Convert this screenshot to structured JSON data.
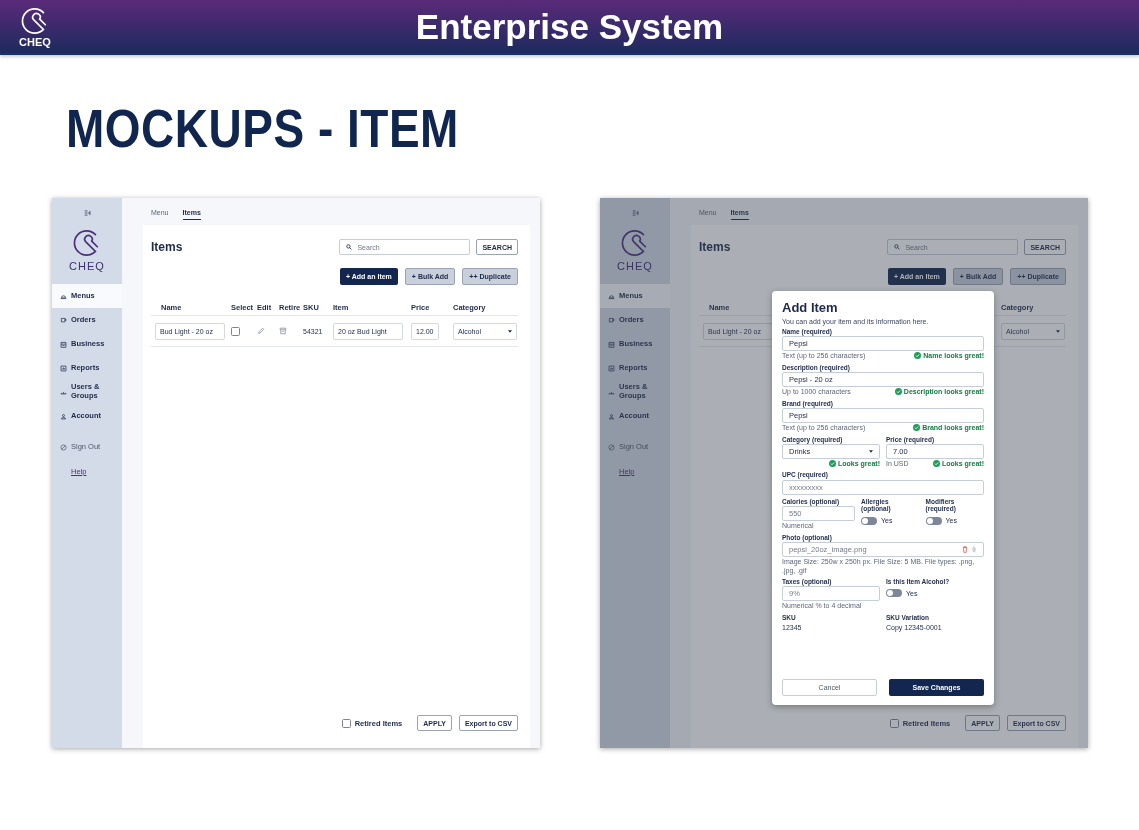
{
  "header": {
    "logo_text": "CHEQ",
    "title": "Enterprise System"
  },
  "slide_title": "MOCKUPS - ITEM",
  "mockups": [
    {
      "dimmed": false,
      "sidebar": {
        "logo_text": "CHEQ",
        "items": [
          {
            "kind": "nav",
            "label": "Menus",
            "selected": true
          },
          {
            "kind": "nav",
            "label": "Orders",
            "selected": false
          },
          {
            "kind": "nav",
            "label": "Business",
            "selected": false
          },
          {
            "kind": "nav",
            "label": "Reports",
            "selected": false
          },
          {
            "kind": "nav",
            "label": "Users & Groups",
            "selected": false
          },
          {
            "kind": "nav",
            "label": "Account",
            "selected": false
          },
          {
            "kind": "signout",
            "label": "Sign Out",
            "selected": false
          },
          {
            "kind": "link",
            "label": "Help",
            "selected": false
          }
        ]
      },
      "tabs": [
        {
          "label": "Menu",
          "selected": false
        },
        {
          "label": "Items",
          "selected": true
        }
      ],
      "page_title": "Items",
      "search": {
        "placeholder": "Search",
        "button": "SEARCH"
      },
      "actions": [
        {
          "kind": "primary",
          "label": "+ Add an Item"
        },
        {
          "kind": "secondary",
          "label": "+ Bulk Add"
        },
        {
          "kind": "secondary",
          "label": "++ Duplicate"
        }
      ],
      "table": {
        "columns": [
          {
            "kind": "name",
            "label": "Name"
          },
          {
            "kind": "select",
            "label": "Select"
          },
          {
            "kind": "edit",
            "label": "Edit"
          },
          {
            "kind": "retire",
            "label": "Retire"
          },
          {
            "kind": "sku",
            "label": "SKU"
          },
          {
            "kind": "item",
            "label": "Item"
          },
          {
            "kind": "price",
            "label": "Price"
          },
          {
            "kind": "category",
            "label": "Category"
          }
        ],
        "rows": [
          {
            "cells": [
              {
                "kind": "field",
                "value": "Bud Light - 20 oz"
              },
              {
                "kind": "checkbox",
                "checked": false
              },
              {
                "kind": "edit"
              },
              {
                "kind": "retire"
              },
              {
                "kind": "text",
                "value": "54321"
              },
              {
                "kind": "field",
                "value": "20 oz Bud Light"
              },
              {
                "kind": "field",
                "value": "12.00"
              },
              {
                "kind": "dropdown",
                "value": "Alcohol"
              }
            ]
          }
        ]
      },
      "footer": {
        "retired": {
          "label": "Retired Items",
          "checked": false
        },
        "buttons": [
          "APPLY",
          "Export to CSV"
        ]
      }
    },
    {
      "dimmed": true,
      "sidebar": {
        "logo_text": "CHEQ",
        "items": [
          {
            "kind": "nav",
            "label": "Menus",
            "selected": true
          },
          {
            "kind": "nav",
            "label": "Orders",
            "selected": false
          },
          {
            "kind": "nav",
            "label": "Business",
            "selected": false
          },
          {
            "kind": "nav",
            "label": "Reports",
            "selected": false
          },
          {
            "kind": "nav",
            "label": "Users & Groups",
            "selected": false
          },
          {
            "kind": "nav",
            "label": "Account",
            "selected": false
          },
          {
            "kind": "signout",
            "label": "Sign Out",
            "selected": false
          },
          {
            "kind": "link",
            "label": "Help",
            "selected": false
          }
        ]
      },
      "tabs": [
        {
          "label": "Menu",
          "selected": false
        },
        {
          "label": "Items",
          "selected": true
        }
      ],
      "page_title": "Items",
      "search": {
        "placeholder": "Search",
        "button": "SEARCH"
      },
      "actions": [
        {
          "kind": "primary",
          "label": "+ Add an Item"
        },
        {
          "kind": "secondary",
          "label": "+ Bulk Add"
        },
        {
          "kind": "secondary",
          "label": "++ Duplicate"
        }
      ],
      "table": {
        "columns": [
          {
            "kind": "name",
            "label": "Name"
          },
          {
            "kind": "category",
            "label": "Category"
          }
        ],
        "rows": [
          {
            "cells": [
              {
                "kind": "field",
                "value": "Bud Light - 20 oz"
              },
              {
                "kind": "dropdown",
                "value": "Alcohol"
              }
            ]
          }
        ]
      },
      "footer": {
        "retired": {
          "label": "Retired Items",
          "checked": false
        },
        "buttons": [
          "APPLY",
          "Export to CSV"
        ]
      },
      "modal": {
        "title": "Add Item",
        "subtitle": "You can add your item and its information here.",
        "rows": [
          [
            {
              "kind": "text",
              "label": "Name (required)",
              "value": "Pepsi",
              "hint": "Text (up to 256 characters)",
              "valid": "Name looks great!"
            }
          ],
          [
            {
              "kind": "text",
              "label": "Description (required)",
              "value": "Pepsi - 20 oz",
              "hint": "Up to 1000 characters",
              "valid": "Description looks great!"
            }
          ],
          [
            {
              "kind": "text",
              "label": "Brand (required)",
              "value": "Pepsi",
              "hint": "Text (up to 256 characters)",
              "valid": "Brand looks great!"
            }
          ],
          [
            {
              "kind": "select",
              "label": "Category (required)",
              "value": "Drinks",
              "valid": "Looks great!"
            },
            {
              "kind": "text",
              "label": "Price (required)",
              "value": "7.00",
              "hint": "In USD",
              "valid": "Looks great!"
            }
          ],
          [
            {
              "kind": "text",
              "label": "UPC (required)",
              "placeholder": "xxxxxxxxx"
            }
          ],
          [
            {
              "kind": "text",
              "label": "Calories (optional)",
              "placeholder": "550",
              "hint": "Numerical"
            },
            {
              "kind": "toggle",
              "label": "Allergies (optional)",
              "text": "Yes",
              "on": false
            },
            {
              "kind": "toggle",
              "label": "Modifiers (required)",
              "text": "Yes",
              "on": false
            }
          ],
          [
            {
              "kind": "file",
              "label": "Photo (optional)",
              "placeholder": "pepsi_20oz_image.png",
              "hint": "Image Size: 250w x 250h px. File Size: 5 MB. File types: .png, .jpg, .gif"
            }
          ],
          [
            {
              "kind": "text",
              "label": "Taxes (optional)",
              "placeholder": "9%",
              "hint": "Numerical % to 4 decimal"
            },
            {
              "kind": "toggle",
              "label": "Is this Item Alcohol?",
              "text": "Yes",
              "on": false
            }
          ],
          [
            {
              "kind": "readonly",
              "label": "SKU",
              "value": "12345"
            },
            {
              "kind": "readonly",
              "label": "SKU Variation",
              "value": "Copy 12345-0001"
            }
          ]
        ],
        "buttons": [
          {
            "kind": "secondary",
            "label": "Cancel"
          },
          {
            "kind": "primary",
            "label": "Save Changes"
          }
        ]
      }
    }
  ]
}
